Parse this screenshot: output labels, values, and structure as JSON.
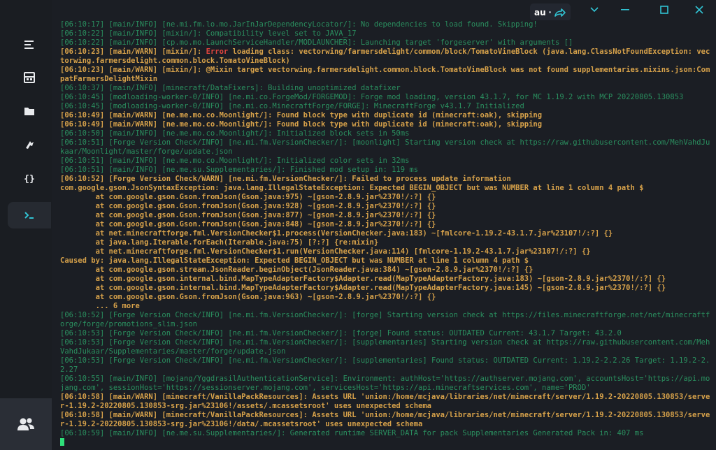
{
  "window": {
    "language_chip": "au",
    "controls": [
      "minimize",
      "maximize",
      "close"
    ]
  },
  "sidebar": {
    "items": [
      {
        "name": "list-icon"
      },
      {
        "name": "server-icon"
      },
      {
        "name": "folder-icon"
      },
      {
        "name": "plugins-icon"
      },
      {
        "name": "code-braces-icon"
      },
      {
        "name": "terminal-icon",
        "active": true
      }
    ],
    "bottom": "users-icon"
  },
  "colors": {
    "info": "#2a8f5f",
    "warn": "#d6a14a",
    "error": "#e0453e",
    "cursor": "#2fe07a",
    "accent": "#31c4d4"
  },
  "console": {
    "lines": [
      {
        "type": "info",
        "text": "[06:10:17] [main/INFO] [ne.mi.fm.lo.mo.JarInJarDependencyLocator/]: No dependencies to load found. Skipping!"
      },
      {
        "type": "info",
        "text": "[06:10:22] [main/INFO] [mixin/]: Compatibility level set to JAVA_17"
      },
      {
        "type": "info",
        "text": "[06:10:22] [main/INFO] [cp.mo.mo.LaunchServiceHandler/MODLAUNCHER]: Launching target 'forgeserver' with arguments []"
      },
      {
        "type": "warn",
        "text": "[06:10:23] [main/WARN] [mixin/]: ",
        "error": "Error",
        "rest": " loading class: vectorwing/farmersdelight/common/block/TomatoVineBlock (java.lang.ClassNotFoundException: vectorwing.farmersdelight.common.block.TomatoVineBlock)"
      },
      {
        "type": "warn",
        "text": "[06:10:23] [main/WARN] [mixin/]: @Mixin target vectorwing.farmersdelight.common.block.TomatoVineBlock was not found supplementaries.mixins.json:CompatFarmersDelightMixin"
      },
      {
        "type": "info",
        "text": "[06:10:37] [main/INFO] [minecraft/DataFixers]: Building unoptimized datafixer"
      },
      {
        "type": "info",
        "text": "[06:10:45] [modloading-worker-0/INFO] [ne.mi.co.ForgeMod/FORGEMOD]: Forge mod loading, version 43.1.7, for MC 1.19.2 with MCP 20220805.130853"
      },
      {
        "type": "info",
        "text": "[06:10:45] [modloading-worker-0/INFO] [ne.mi.co.MinecraftForge/FORGE]: MinecraftForge v43.1.7 Initialized"
      },
      {
        "type": "warn",
        "text": "[06:10:49] [main/WARN] [ne.me.mo.co.Moonlight/]: Found block type with duplicate id (minecraft:oak), skipping"
      },
      {
        "type": "warn",
        "text": "[06:10:49] [main/WARN] [ne.me.mo.co.Moonlight/]: Found block type with duplicate id (minecraft:oak), skipping"
      },
      {
        "type": "info",
        "text": "[06:10:50] [main/INFO] [ne.me.mo.co.Moonlight/]: Initialized block sets in 50ms"
      },
      {
        "type": "info",
        "text": "[06:10:51] [Forge Version Check/INFO] [ne.mi.fm.VersionChecker/]: [moonlight] Starting version check at https://raw.githubusercontent.com/MehVahdJukaar/Moonlight/master/forge/update.json"
      },
      {
        "type": "info",
        "text": "[06:10:51] [main/INFO] [ne.me.mo.co.Moonlight/]: Initialized color sets in 32ms"
      },
      {
        "type": "info",
        "text": "[06:10:51] [main/INFO] [ne.me.su.Supplementaries/]: Finished mod setup in: 119 ms"
      },
      {
        "type": "warn",
        "text": "[06:10:52] [Forge Version Check/WARN] [ne.mi.fm.VersionChecker/]: Failed to process update information"
      },
      {
        "type": "warn",
        "text": "com.google.gson.JsonSyntaxException: java.lang.IllegalStateException: Expected BEGIN_OBJECT but was NUMBER at line 1 column 4 path $"
      },
      {
        "type": "warn",
        "text": "        at com.google.gson.Gson.fromJson(Gson.java:975) ~[gson-2.8.9.jar%2370!/:?] {}"
      },
      {
        "type": "warn",
        "text": "        at com.google.gson.Gson.fromJson(Gson.java:928) ~[gson-2.8.9.jar%2370!/:?] {}"
      },
      {
        "type": "warn",
        "text": "        at com.google.gson.Gson.fromJson(Gson.java:877) ~[gson-2.8.9.jar%2370!/:?] {}"
      },
      {
        "type": "warn",
        "text": "        at com.google.gson.Gson.fromJson(Gson.java:848) ~[gson-2.8.9.jar%2370!/:?] {}"
      },
      {
        "type": "warn",
        "text": "        at net.minecraftforge.fml.VersionChecker$1.process(VersionChecker.java:183) ~[fmlcore-1.19.2-43.1.7.jar%23107!/:?] {}"
      },
      {
        "type": "warn",
        "text": "        at java.lang.Iterable.forEach(Iterable.java:75) [?:?] {re:mixin}"
      },
      {
        "type": "warn",
        "text": "        at net.minecraftforge.fml.VersionChecker$1.run(VersionChecker.java:114) [fmlcore-1.19.2-43.1.7.jar%23107!/:?] {}"
      },
      {
        "type": "warn",
        "text": "Caused by: java.lang.IllegalStateException: Expected BEGIN_OBJECT but was NUMBER at line 1 column 4 path $"
      },
      {
        "type": "warn",
        "text": "        at com.google.gson.stream.JsonReader.beginObject(JsonReader.java:384) ~[gson-2.8.9.jar%2370!/:?] {}"
      },
      {
        "type": "warn",
        "text": "        at com.google.gson.internal.bind.MapTypeAdapterFactory$Adapter.read(MapTypeAdapterFactory.java:183) ~[gson-2.8.9.jar%2370!/:?] {}"
      },
      {
        "type": "warn",
        "text": "        at com.google.gson.internal.bind.MapTypeAdapterFactory$Adapter.read(MapTypeAdapterFactory.java:145) ~[gson-2.8.9.jar%2370!/:?] {}"
      },
      {
        "type": "warn",
        "text": "        at com.google.gson.Gson.fromJson(Gson.java:963) ~[gson-2.8.9.jar%2370!/:?] {}"
      },
      {
        "type": "warn",
        "text": "        ... 6 more"
      },
      {
        "type": "info",
        "text": "[06:10:52] [Forge Version Check/INFO] [ne.mi.fm.VersionChecker/]: [forge] Starting version check at https://files.minecraftforge.net/net/minecraftforge/forge/promotions_slim.json"
      },
      {
        "type": "info",
        "text": "[06:10:53] [Forge Version Check/INFO] [ne.mi.fm.VersionChecker/]: [forge] Found status: OUTDATED Current: 43.1.7 Target: 43.2.0"
      },
      {
        "type": "info",
        "text": "[06:10:53] [Forge Version Check/INFO] [ne.mi.fm.VersionChecker/]: [supplementaries] Starting version check at https://raw.githubusercontent.com/MehVahdJukaar/Supplementaries/master/forge/update.json"
      },
      {
        "type": "info",
        "text": "[06:10:53] [Forge Version Check/INFO] [ne.mi.fm.VersionChecker/]: [supplementaries] Found status: OUTDATED Current: 1.19.2-2.2.26 Target: 1.19.2-2.2.27"
      },
      {
        "type": "info",
        "text": "[06:10:55] [main/INFO] [mojang/YggdrasilAuthenticationService]: Environment: authHost='https://authserver.mojang.com', accountsHost='https://api.mojang.com', sessionHost='https://sessionserver.mojang.com', servicesHost='https://api.minecraftservices.com', name='PROD'"
      },
      {
        "type": "warn",
        "text": "[06:10:58] [main/WARN] [minecraft/VanillaPackResources]: Assets URL 'union:/home/mcjava/libraries/net/minecraft/server/1.19.2-20220805.130853/server-1.19.2-20220805.130853-srg.jar%23106!/assets/.mcassetsroot' uses unexpected schema"
      },
      {
        "type": "warn",
        "text": "[06:10:58] [main/WARN] [minecraft/VanillaPackResources]: Assets URL 'union:/home/mcjava/libraries/net/minecraft/server/1.19.2-20220805.130853/server-1.19.2-20220805.130853-srg.jar%23106!/data/.mcassetsroot' uses unexpected schema"
      },
      {
        "type": "info",
        "text": "[06:10:59] [main/INFO] [ne.me.su.Supplementaries/]: Generated runtime SERVER_DATA for pack Supplementaries Generated Pack in: 407 ms"
      }
    ]
  }
}
